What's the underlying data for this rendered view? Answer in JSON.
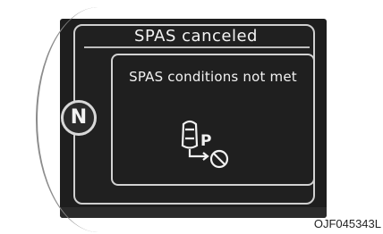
{
  "cluster": {
    "title": "SPAS canceled",
    "message": "SPAS conditions not met",
    "gear": "N",
    "parking_letter": "P"
  },
  "figure_code": "OJF045343L",
  "icons": {
    "gear_indicator": "gear-indicator-icon",
    "parking": "parking-assist-prohibited-icon"
  },
  "colors": {
    "display_background": "#1e1e1e",
    "text": "#f2f2f2",
    "border": "#d2d2d2"
  }
}
